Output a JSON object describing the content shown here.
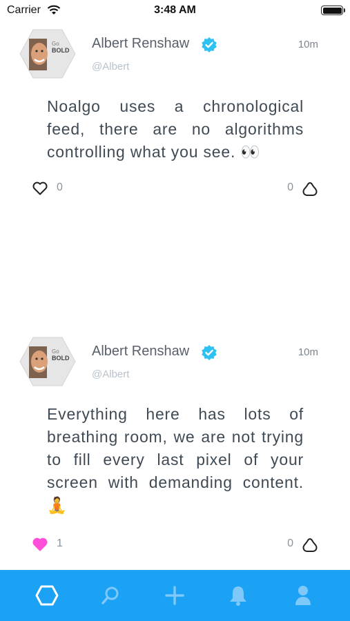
{
  "status_bar": {
    "carrier": "Carrier",
    "time": "3:48 AM"
  },
  "posts": [
    {
      "author": "Albert Renshaw",
      "handle": "@Albert",
      "time": "10m",
      "avatar_text": [
        "Go",
        "BOLD"
      ],
      "body": "Noalgo uses a chronological feed, there are no algorithms controlling what you see. 👀",
      "likes": "0",
      "liked": false,
      "reposts": "0"
    },
    {
      "author": "Albert Renshaw",
      "handle": "@Albert",
      "time": "10m",
      "avatar_text": [
        "Go",
        "BOLD"
      ],
      "body": "Everything here has lots of breathing room, we are not trying to fill every last pixel of your screen with demanding content. 🧘",
      "likes": "1",
      "liked": true,
      "reposts": "0"
    }
  ],
  "tab_bar": {
    "tabs": [
      {
        "icon": "hexagon-home-icon",
        "active": true
      },
      {
        "icon": "search-icon",
        "active": false
      },
      {
        "icon": "plus-icon",
        "active": false
      },
      {
        "icon": "bell-icon",
        "active": false
      },
      {
        "icon": "profile-icon",
        "active": false
      }
    ]
  },
  "colors": {
    "accent": "#1ba2f5",
    "like_active": "#ff4fd8",
    "verified": "#2fc1f2",
    "tab_inactive": "#7ec8fa"
  }
}
